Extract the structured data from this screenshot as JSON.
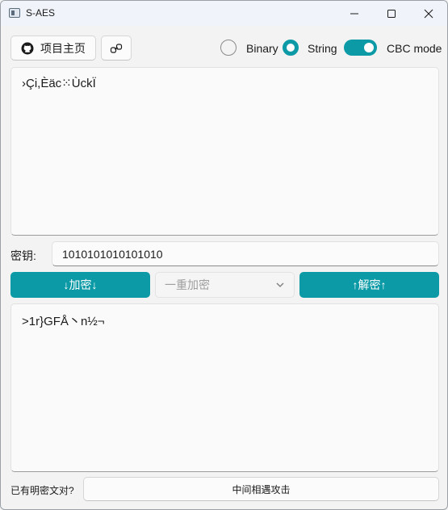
{
  "window": {
    "title": "S-AES"
  },
  "toolbar": {
    "home_label": "项目主页",
    "binary_label": "Binary",
    "string_label": "String",
    "cbc_label": "CBC mode",
    "binary_selected": false,
    "string_selected": true,
    "cbc_enabled": true
  },
  "input": {
    "text": "›Çi,Èäc⁙ÙckÏ"
  },
  "key": {
    "label": "密钥:",
    "value": "1010101010101010"
  },
  "actions": {
    "encrypt_label": "↓加密↓",
    "mode_value": "一重加密",
    "decrypt_label": "↑解密↑"
  },
  "output": {
    "text": ">1r}GFÅ丶n½¬"
  },
  "footer": {
    "question_label": "已有明密文对?",
    "attack_label": "中间相遇攻击"
  },
  "colors": {
    "accent": "#0b9aa6"
  }
}
